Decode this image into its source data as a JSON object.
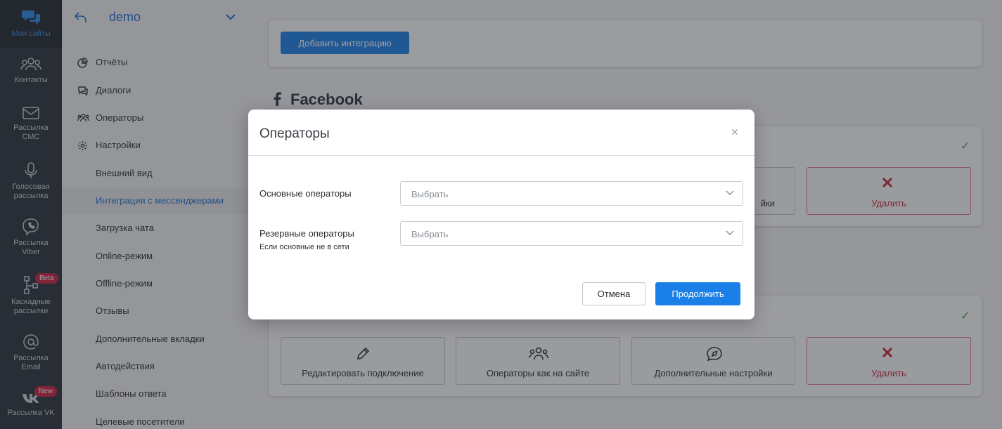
{
  "rail": {
    "items": [
      {
        "label": "Мои сайты",
        "icon": "chat-bubbles-icon"
      },
      {
        "label": "Контакты",
        "icon": "contacts-icon"
      },
      {
        "label": "Рассылка СМС",
        "icon": "mail-icon"
      },
      {
        "label": "Голосовая рассылка",
        "icon": "microphone-icon"
      },
      {
        "label": "Рассылка Viber",
        "icon": "viber-icon"
      },
      {
        "label": "Каскадные рассылки",
        "icon": "cascade-icon",
        "badge": "Beta"
      },
      {
        "label": "Рассылка Email",
        "icon": "at-icon"
      },
      {
        "label": "Рассылка VK",
        "icon": "vk-icon",
        "badge": "New"
      }
    ]
  },
  "sidebar": {
    "site_name": "demo",
    "items": [
      {
        "label": "Отчёты",
        "icon": "pie-chart-icon"
      },
      {
        "label": "Диалоги",
        "icon": "dialogs-icon"
      },
      {
        "label": "Операторы",
        "icon": "operators-icon"
      },
      {
        "label": "Настройки",
        "icon": "gear-icon"
      },
      {
        "label": "Внешний вид"
      },
      {
        "label": "Интеграция с мессенджерами",
        "selected": true
      },
      {
        "label": "Загрузка чата"
      },
      {
        "label": "Online-режим"
      },
      {
        "label": "Offline-режим"
      },
      {
        "label": "Отзывы"
      },
      {
        "label": "Дополнительные вкладки"
      },
      {
        "label": "Автодействия"
      },
      {
        "label": "Шаблоны ответа"
      },
      {
        "label": "Целевые посетители"
      }
    ]
  },
  "main": {
    "add_integration_label": "Добавить интеграцию",
    "facebook_title": "Facebook",
    "tiles_top": {
      "partial_label": "йки",
      "delete_label": "Удалить"
    },
    "tiles_bottom": {
      "edit_label": "Редактировать подключение",
      "operators_label": "Операторы как на сайте",
      "settings_label": "Дополнительные настройки",
      "delete_label": "Удалить"
    }
  },
  "modal": {
    "title": "Операторы",
    "close_glyph": "×",
    "primary_label": "Основные операторы",
    "primary_placeholder": "Выбрать",
    "backup_label": "Резервные операторы",
    "backup_hint": "Если основные не в сети",
    "backup_placeholder": "Выбрать",
    "cancel_label": "Отмена",
    "continue_label": "Продолжить"
  },
  "colors": {
    "accent": "#1a7fe6",
    "danger": "#c4253d",
    "success": "#3fa346"
  }
}
